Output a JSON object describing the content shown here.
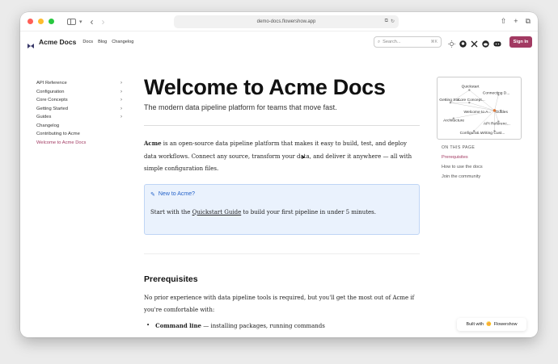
{
  "browser": {
    "url": "demo-docs.flowershow.app",
    "traffic_colors": [
      "#ff5f57",
      "#febc2e",
      "#28c840"
    ]
  },
  "header": {
    "brand": "Acme Docs",
    "nav": [
      "Docs",
      "Blog",
      "Changelog"
    ],
    "search_placeholder": "Search...",
    "search_shortcut": "⌘K",
    "signin_label": "Sign In",
    "accent": "#a23a62"
  },
  "sidebar": {
    "items": [
      {
        "label": "API Reference",
        "arrow": "›"
      },
      {
        "label": "Configuration",
        "arrow": "›"
      },
      {
        "label": "Core Concepts",
        "arrow": "›"
      },
      {
        "label": "Getting Started",
        "arrow": "›"
      },
      {
        "label": "Guides",
        "arrow": "›"
      },
      {
        "label": "Changelog",
        "arrow": ""
      },
      {
        "label": "Contributing to Acme",
        "arrow": ""
      },
      {
        "label": "Welcome to Acme Docs",
        "arrow": "",
        "active": true
      }
    ]
  },
  "main": {
    "title": "Welcome to Acme Docs",
    "subtitle": "The modern data pipeline platform for teams that move fast.",
    "intro_bold": "Acme",
    "intro_rest": " is an open-source data pipeline platform that makes it easy to build, test, and deploy data workflows. Connect any source, transform your data, and deliver it anywhere — all with simple configuration files.",
    "callout": {
      "title": "New to Acme?",
      "body_before": "Start with the ",
      "link": "Quickstart Guide",
      "body_after": " to build your first pipeline in under 5 minutes."
    },
    "section_title": "Prerequisites",
    "section_para": "No prior experience with data pipeline tools is required, but you'll get the most out of Acme if you're comfortable with:",
    "bullet_bold": "Command line",
    "bullet_rest": " — installing packages, running commands"
  },
  "graph": {
    "nodes": [
      "Quickstart",
      "Connecting D...",
      "Getting Sta...",
      "Core Concept...",
      "Welcome to A...",
      "Guides",
      "Architecture",
      "API Referenc...",
      "Configurati...",
      "Writing Cust..."
    ]
  },
  "toc": {
    "title": "ON THIS PAGE",
    "items": [
      {
        "label": "Prerequisites",
        "active": true
      },
      {
        "label": "How to use the docs"
      },
      {
        "label": "Join the community"
      }
    ]
  },
  "footer_badge": {
    "prefix": "Built with",
    "brand": "Flowershow"
  }
}
